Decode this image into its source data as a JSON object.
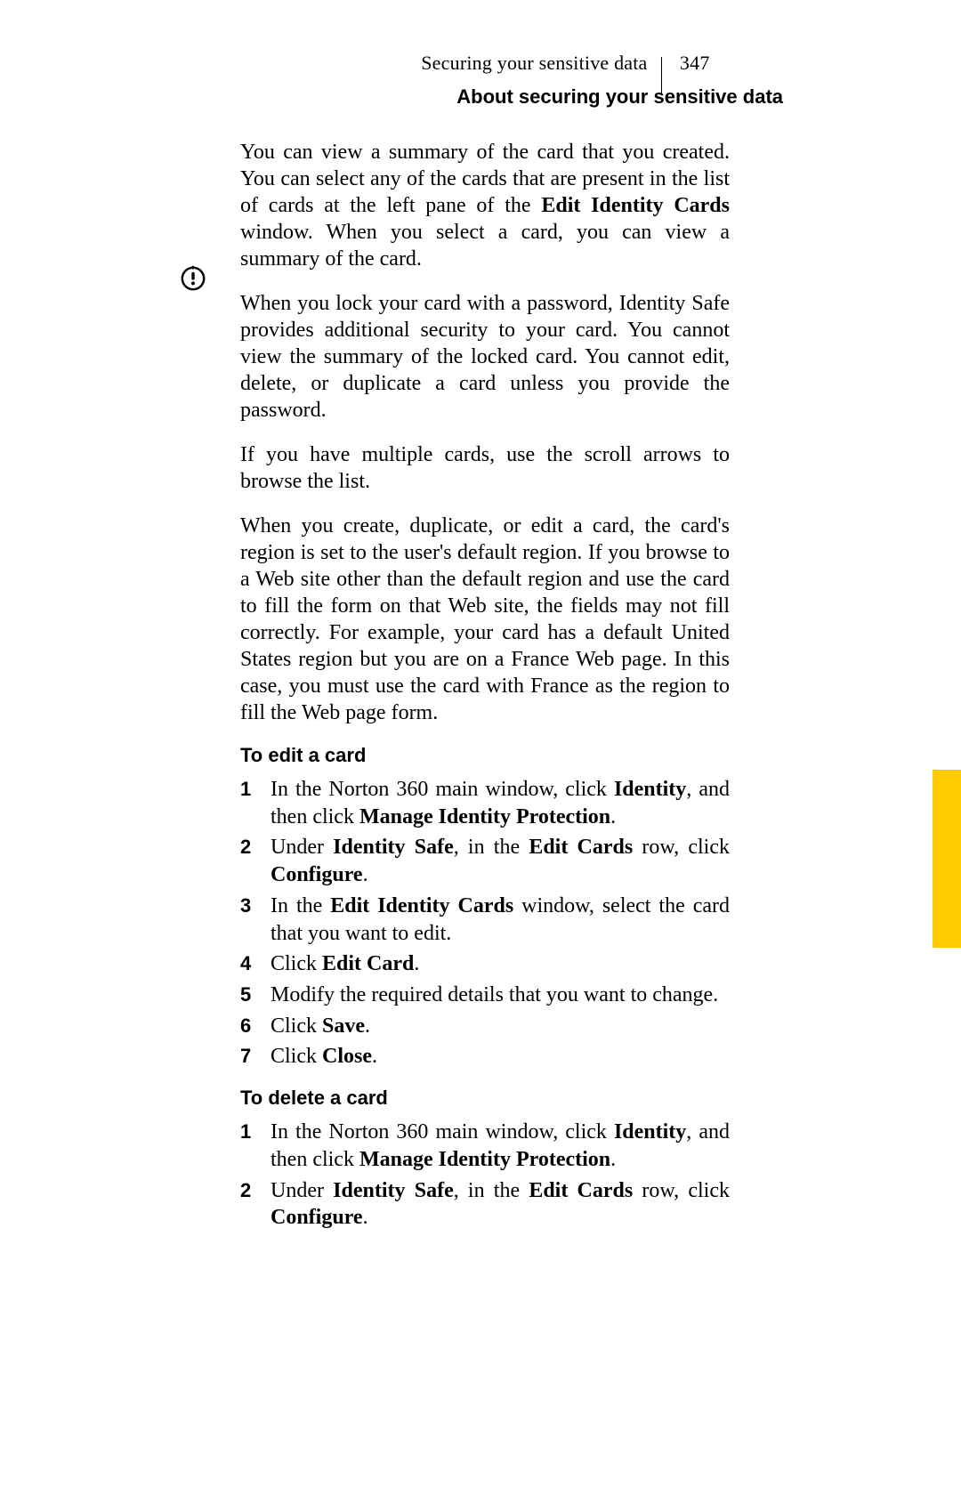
{
  "header": {
    "title": "Securing your sensitive data",
    "page_number": "347",
    "subtitle": "About securing your sensitive data"
  },
  "body": {
    "p1_a": "You can view a summary of the card that you created. You can select any of the cards that are present in the list of cards at the left pane of the ",
    "p1_b": "Edit Identity Cards",
    "p1_c": " window. When you select a card, you can view a summary of the card.",
    "p2": "When you lock your card with a password, Identity Safe provides additional security to your card. You cannot view the summary of the locked card. You cannot edit, delete, or duplicate a card unless you provide the password.",
    "p3": "If you have multiple cards, use the scroll arrows to browse the list.",
    "p4": "When you create, duplicate, or edit a card, the card's region is set to the user's default region. If you browse to a Web site other than the default region and use the card to fill the form on that Web site, the fields may not fill correctly. For example, your card has a default United States region but you are on a France Web page. In this case, you must use the card with France as the region to fill the Web page form."
  },
  "edit": {
    "heading": "To edit a card",
    "s1_a": "In the Norton 360 main window, click ",
    "s1_b": "Identity",
    "s1_c": ", and then click ",
    "s1_d": "Manage Identity Protection",
    "s1_e": ".",
    "s2_a": "Under ",
    "s2_b": "Identity Safe",
    "s2_c": ", in the ",
    "s2_d": "Edit Cards",
    "s2_e": " row, click ",
    "s2_f": "Configure",
    "s2_g": ".",
    "s3_a": "In the ",
    "s3_b": "Edit Identity Cards",
    "s3_c": " window, select the card that you want to edit.",
    "s4_a": "Click ",
    "s4_b": "Edit Card",
    "s4_c": ".",
    "s5": "Modify the required details that you want to change.",
    "s6_a": "Click ",
    "s6_b": "Save",
    "s6_c": ".",
    "s7_a": "Click ",
    "s7_b": "Close",
    "s7_c": "."
  },
  "del": {
    "heading": "To delete a card",
    "s1_a": "In the Norton 360 main window, click ",
    "s1_b": "Identity",
    "s1_c": ", and then click ",
    "s1_d": "Manage Identity Protection",
    "s1_e": ".",
    "s2_a": "Under ",
    "s2_b": "Identity Safe",
    "s2_c": ", in the ",
    "s2_d": "Edit Cards",
    "s2_e": " row, click ",
    "s2_f": "Configure",
    "s2_g": "."
  }
}
